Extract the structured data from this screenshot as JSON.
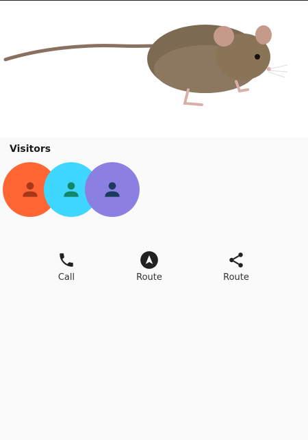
{
  "hero": {
    "image_subject": "mouse"
  },
  "visitors": {
    "title": "Visitors",
    "avatars": [
      {
        "bg": "#ff6633",
        "fg": "#a8361b",
        "icon": "person-icon"
      },
      {
        "bg": "#3fd6ff",
        "fg": "#13876a",
        "icon": "person-icon"
      },
      {
        "bg": "#8b7fe2",
        "fg": "#1b3b5e",
        "icon": "person-icon"
      }
    ]
  },
  "actions": [
    {
      "label": "Call",
      "icon": "phone-icon"
    },
    {
      "label": "Route",
      "icon": "navigation-icon"
    },
    {
      "label": "Route",
      "icon": "share-icon"
    }
  ],
  "colors": {
    "background": "#fafafa",
    "icon": "#222222",
    "text": "#333333"
  }
}
